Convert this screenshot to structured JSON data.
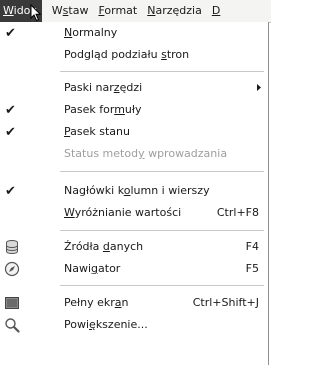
{
  "menubar": {
    "items": [
      {
        "text": "Widok",
        "ul": "W",
        "rest": "idok"
      },
      {
        "text": "Wstaw",
        "ul": "s",
        "pre": "W",
        "rest": "taw"
      },
      {
        "text": "Format",
        "ul": "F",
        "rest": "ormat"
      },
      {
        "text": "Narzędzia",
        "ul": "N",
        "rest": "arzędzia"
      },
      {
        "text": "D",
        "ul": "D",
        "rest": ""
      }
    ]
  },
  "menu": {
    "normalny": {
      "label_ul": "N",
      "label_rest": "ormalny"
    },
    "podglad": {
      "label": "Podgląd podziału stron",
      "label_pre": "Podgląd podziału ",
      "label_ul": "s",
      "label_rest": "tron"
    },
    "paski": {
      "label_pre": "Paski nar",
      "label_ul": "z",
      "label_rest": "ędzi"
    },
    "pasek_formuly": {
      "label_pre": "Pasek for",
      "label_ul": "m",
      "label_rest": "uły"
    },
    "pasek_stanu": {
      "label_ul": "P",
      "label_rest": "asek stanu"
    },
    "status": {
      "label_pre": "Status metod",
      "label_ul": "y",
      "label_rest": " wprowadzania"
    },
    "naglowki": {
      "label_pre": "Nagłówki k",
      "label_ul": "o",
      "label_rest": "lumn i wierszy"
    },
    "wyroznianie": {
      "label_ul": "W",
      "label_rest": "yróżnianie wartości",
      "shortcut": "Ctrl+F8"
    },
    "zrodla": {
      "label_pre": "Źródła ",
      "label_ul": "d",
      "label_rest": "anych",
      "shortcut": "F4"
    },
    "nawigator": {
      "label_pre": "Nawi",
      "label_ul": "g",
      "label_rest": "ator",
      "shortcut": "F5"
    },
    "pelny": {
      "label_pre": "Pełny ekr",
      "label_ul": "a",
      "label_rest": "n",
      "shortcut": "Ctrl+Shift+J"
    },
    "powiekszenie": {
      "label_pre": "Powi",
      "label_ul": "ę",
      "label_rest": "kszenie..."
    }
  }
}
